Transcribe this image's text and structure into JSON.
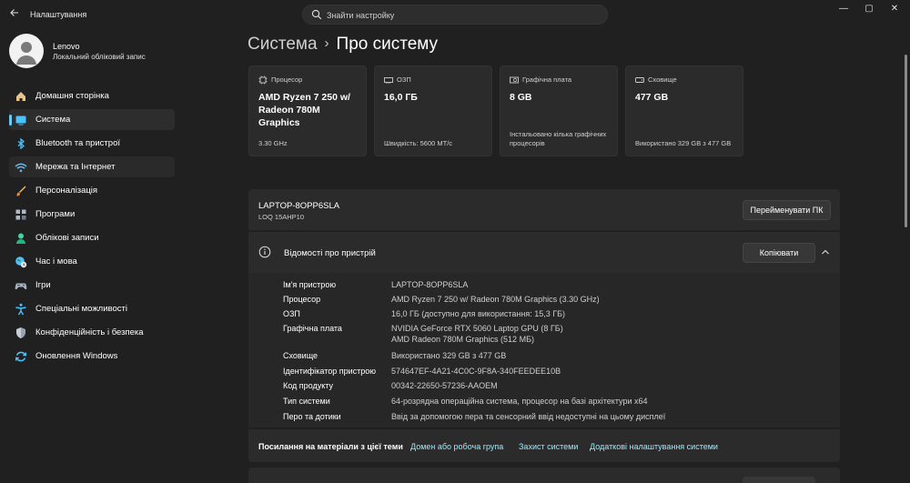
{
  "window": {
    "title": "Налаштування",
    "controls": {
      "minimize": "—",
      "maximize": "▢",
      "close": "✕"
    }
  },
  "search": {
    "placeholder": "Знайти настройку"
  },
  "user": {
    "name": "Lenovo",
    "account": "Локальний обліковий запис"
  },
  "sidebar": {
    "items": [
      {
        "label": "Домашня сторінка",
        "icon": "home-icon"
      },
      {
        "label": "Система",
        "icon": "system-icon",
        "active": true
      },
      {
        "label": "Bluetooth та пристрої",
        "icon": "bluetooth-icon"
      },
      {
        "label": "Мережа та Інтернет",
        "icon": "network-icon"
      },
      {
        "label": "Персоналізація",
        "icon": "personalization-icon"
      },
      {
        "label": "Програми",
        "icon": "apps-icon"
      },
      {
        "label": "Облікові записи",
        "icon": "accounts-icon"
      },
      {
        "label": "Час і мова",
        "icon": "time-language-icon"
      },
      {
        "label": "Ігри",
        "icon": "gaming-icon"
      },
      {
        "label": "Спеціальні можливості",
        "icon": "accessibility-icon"
      },
      {
        "label": "Конфіденційність і безпека",
        "icon": "privacy-shield-icon"
      },
      {
        "label": "Оновлення Windows",
        "icon": "windows-update-icon"
      }
    ]
  },
  "breadcrumb": {
    "parent": "Система",
    "separator": "›",
    "current": "Про систему"
  },
  "cards": [
    {
      "label": "Процесор",
      "value": "AMD Ryzen 7 250 w/ Radeon 780M Graphics",
      "sub": "3.30 GHz",
      "icon": "cpu-icon"
    },
    {
      "label": "ОЗП",
      "value": "16,0 ГБ",
      "sub": "Швидкість: 5600 MT/с",
      "icon": "ram-icon"
    },
    {
      "label": "Графічна плата",
      "value": "8 GB",
      "sub": "Інстальовано кілька графічних процесорів",
      "icon": "gpu-icon"
    },
    {
      "label": "Сховище",
      "value": "477 GB",
      "sub": "Використано 329 GB з 477 GB",
      "icon": "storage-icon"
    }
  ],
  "pc": {
    "name": "LAPTOP-8OPP6SLA",
    "model": "LOQ 15AHP10",
    "rename_label": "Перейменувати ПК"
  },
  "device_specs": {
    "title": "Відомості про пристрій",
    "copy_label": "Копіювати",
    "rows": [
      {
        "key": "Ім'я пристрою",
        "value": "LAPTOP-8OPP6SLA"
      },
      {
        "key": "Процесор",
        "value": "AMD Ryzen 7 250 w/ Radeon 780M Graphics (3.30 GHz)"
      },
      {
        "key": "ОЗП",
        "value": "16,0 ГБ (доступно для використання: 15,3 ГБ)"
      },
      {
        "key": "Графічна плата",
        "value": "NVIDIA GeForce RTX 5060 Laptop GPU (8 ГБ)",
        "value2": "AMD Radeon 780M Graphics (512 МБ)"
      },
      {
        "key": "Сховище",
        "value": "Використано 329 GB з 477 GB"
      },
      {
        "key": "Ідентифікатор пристрою",
        "value": "574647EF-4A21-4C0C-9F8A-340FEEDEE10B"
      },
      {
        "key": "Код продукту",
        "value": "00342-22650-57236-AAOEM"
      },
      {
        "key": "Тип системи",
        "value": "64-розрядна операційна система, процесор на базі архітектури x64"
      },
      {
        "key": "Перо та дотики",
        "value": "Ввід за допомогою пера та сенсорний ввід недоступні на цьому дисплеї"
      }
    ]
  },
  "related": {
    "label": "Посилання на матеріали з цієї теми",
    "links": [
      "Домен або робоча група",
      "Захист системи",
      "Додаткові налаштування системи"
    ]
  },
  "colors": {
    "accent": "#60cdff",
    "link": "#99ebff",
    "background": "#202020",
    "card": "#2b2b2b"
  }
}
